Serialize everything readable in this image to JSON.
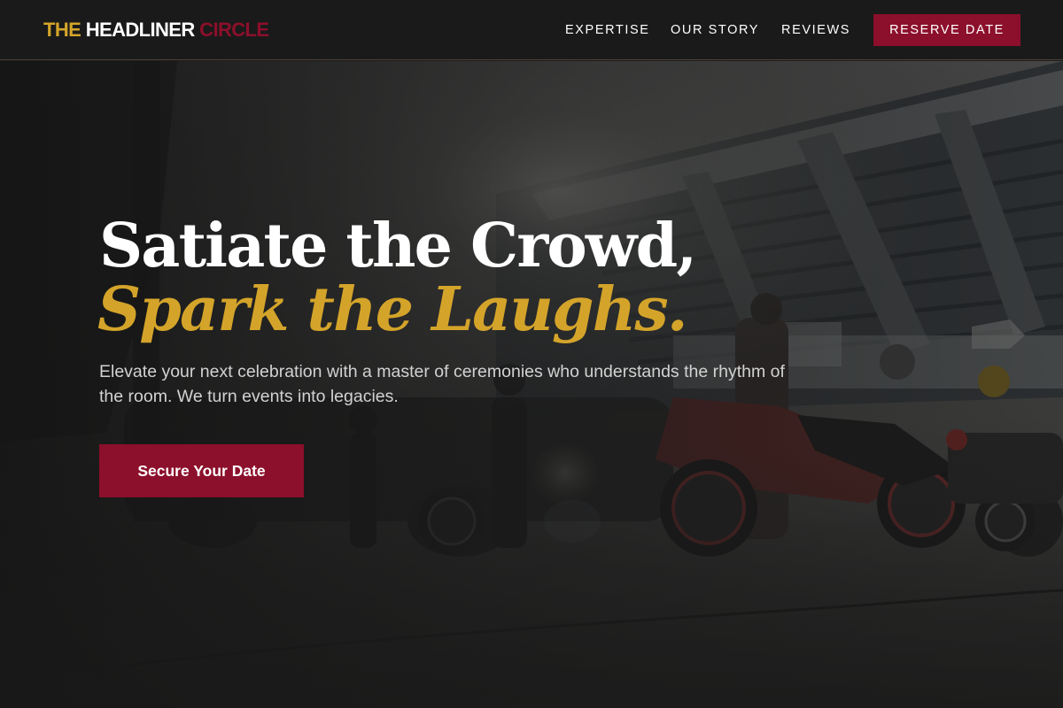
{
  "brand": {
    "part1": "THE",
    "part2": "HEADLINER",
    "part3": "CIRCLE"
  },
  "nav": {
    "links": [
      "EXPERTISE",
      "OUR STORY",
      "REVIEWS"
    ],
    "cta_label": "RESERVE DATE"
  },
  "hero": {
    "headline_line1": "Satiate the Crowd,",
    "headline_line2": "Spark the Laughs.",
    "subtext": "Elevate your next celebration with a master of ceremonies who understands the rhythm of the room. We turn events into legacies.",
    "cta_label": "Secure Your Date",
    "background": "dim-photo-motorcycles-outside-stadium"
  },
  "colors": {
    "accent_gold": "#d4a42a",
    "accent_crimson": "#8c0f2b",
    "nav_bg": "#1a1a1a",
    "text_light": "#ffffff"
  }
}
